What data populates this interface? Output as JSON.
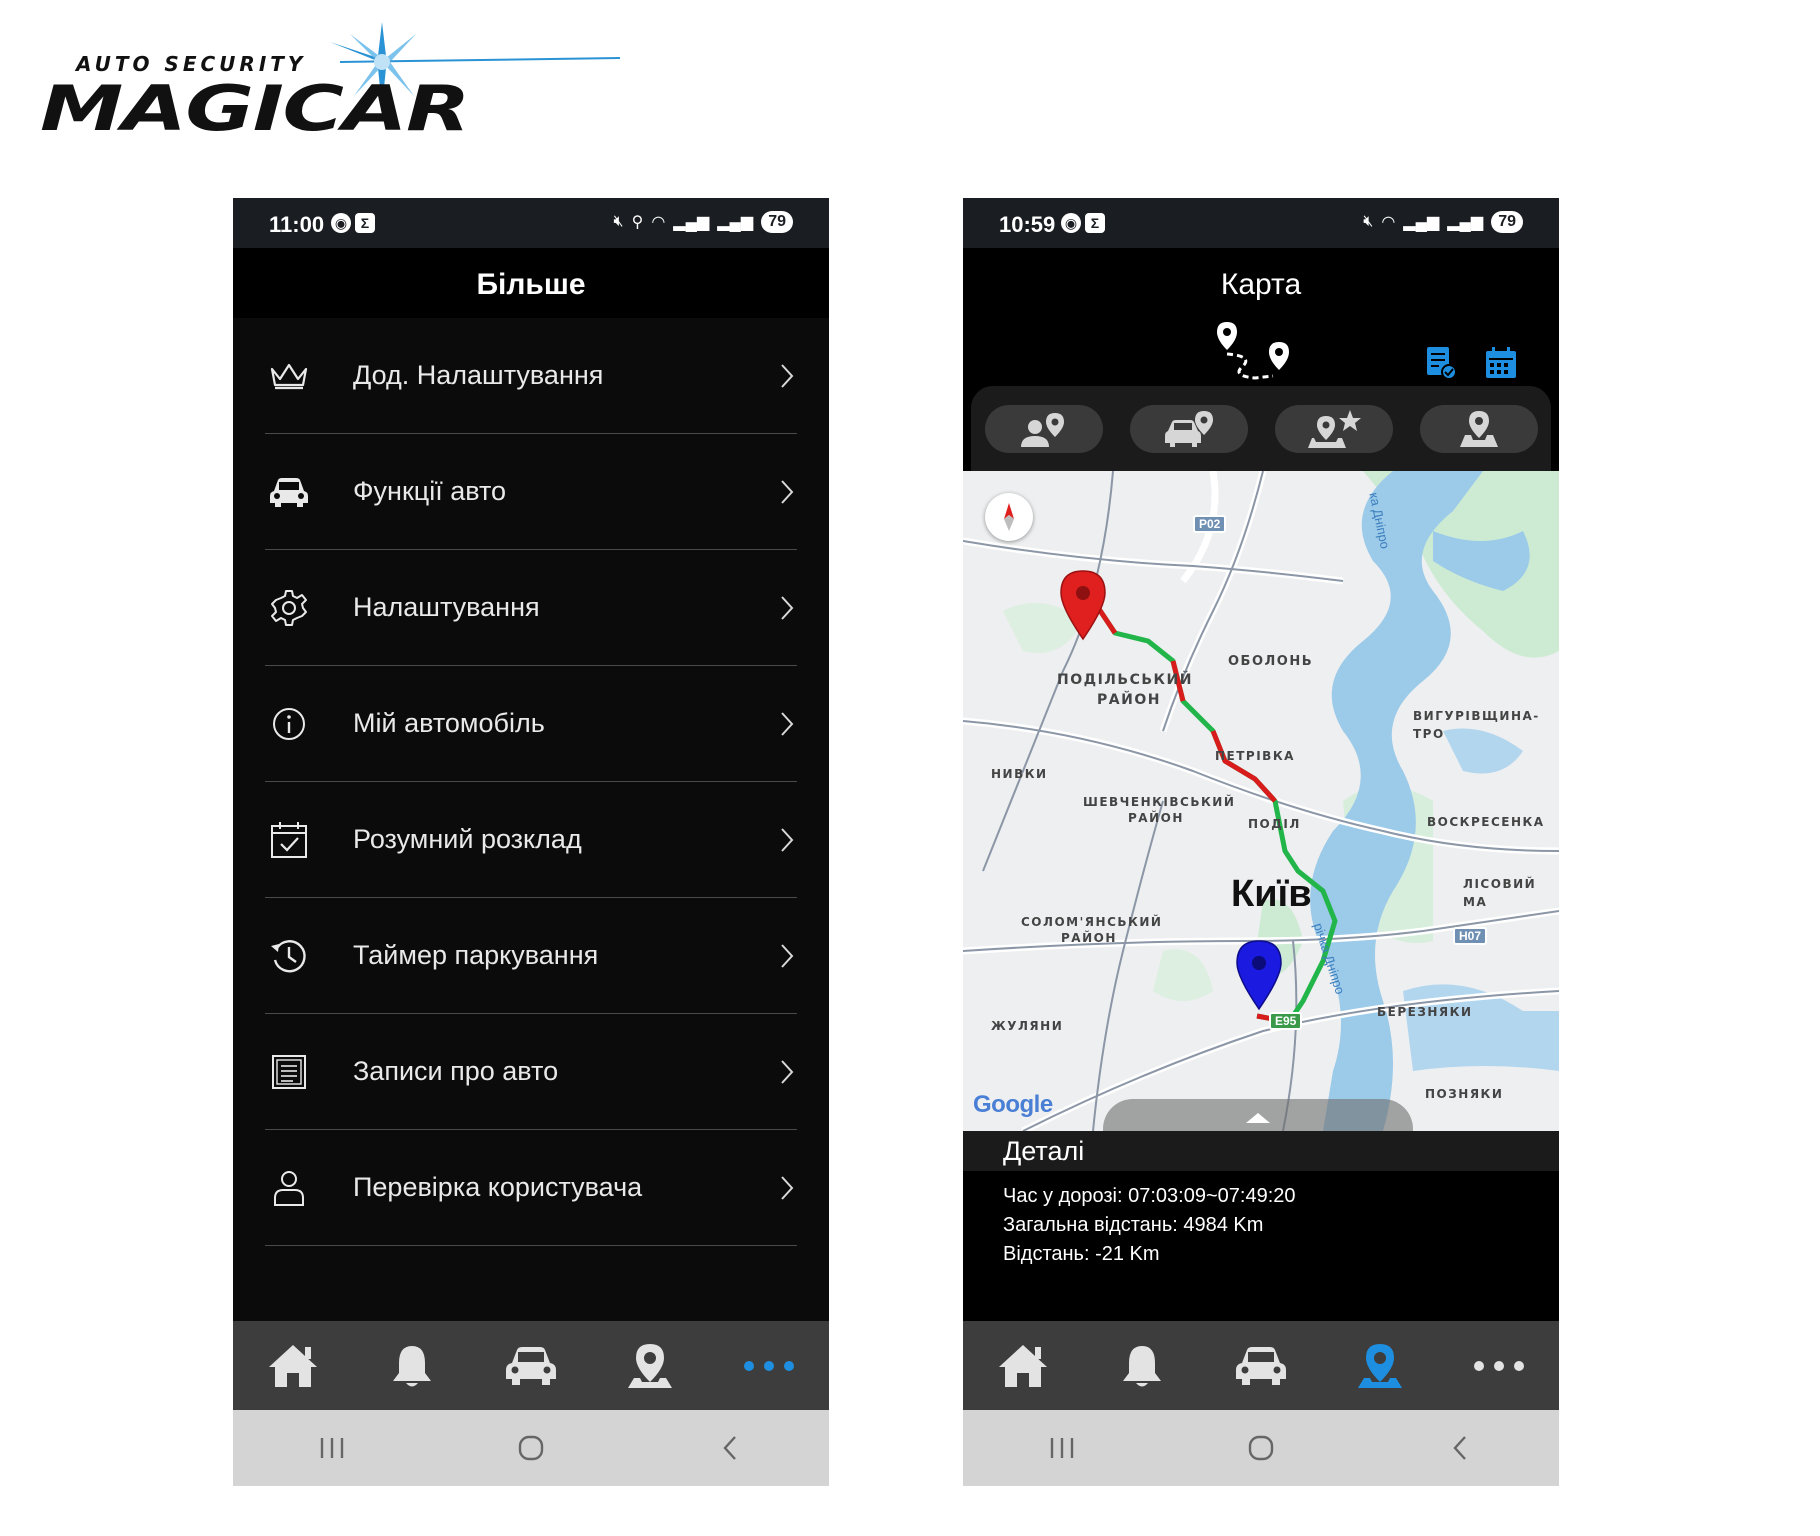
{
  "logo": {
    "tagline": "AUTO SECURITY",
    "wordmark": "MAGICAR"
  },
  "left_phone": {
    "status": {
      "time": "11:00",
      "battery": "79"
    },
    "title": "Більше",
    "menu": [
      {
        "icon": "crown-icon",
        "label": "Дод. Налаштування"
      },
      {
        "icon": "car-icon",
        "label": "Функції авто"
      },
      {
        "icon": "gear-icon",
        "label": "Налаштування"
      },
      {
        "icon": "info-icon",
        "label": "Мій автомобіль"
      },
      {
        "icon": "calendar-check-icon",
        "label": "Розумний розклад"
      },
      {
        "icon": "history-icon",
        "label": "Таймер паркування"
      },
      {
        "icon": "notes-icon",
        "label": "Записи про авто"
      },
      {
        "icon": "user-icon",
        "label": "Перевірка користувача"
      }
    ],
    "tabs": [
      "home-icon",
      "bell-icon",
      "car-icon",
      "location-icon",
      "more-icon"
    ],
    "active_tab": "more",
    "accent": "#1e8fe0"
  },
  "right_phone": {
    "status": {
      "time": "10:59",
      "battery": "79"
    },
    "title": "Карта",
    "filters": [
      "person-location-icon",
      "car-location-icon",
      "favorite-location-icon",
      "map-location-icon"
    ],
    "map": {
      "city": "Київ",
      "districts": [
        "ПОДІЛЬСЬКИЙ",
        "РАЙОН",
        "ОБОЛОНЬ",
        "ВИГУРІВЩИНА-ТРО",
        "ПЕТРІВКА",
        "НИВКИ",
        "ШЕВЧЕНКІВСЬКИЙ",
        "РАЙОН",
        "ПОДІЛ",
        "ВОСКРЕСЕНКА",
        "ЛІСОВИЙ МА",
        "СОЛОМ'ЯНСЬКИЙ",
        "РАЙОН",
        "ЖУЛЯНИ",
        "БЕРЕЗНЯКИ",
        "ПОЗНЯКИ"
      ],
      "roads": [
        "P02",
        "H07",
        "E95"
      ],
      "rivers": [
        "ка Дніпро",
        "річка Дніпро"
      ],
      "attribution": "Google"
    },
    "details": {
      "title": "Деталі",
      "travel_time": "Час у дорозі: 07:03:09~07:49:20",
      "total_distance": "Загальна відстань: 4984 Km",
      "distance": "Відстань: -21 Km"
    },
    "tabs": [
      "home-icon",
      "bell-icon",
      "car-icon",
      "location-icon",
      "more-icon"
    ],
    "active_tab": "location",
    "accent": "#1e8fe0"
  }
}
